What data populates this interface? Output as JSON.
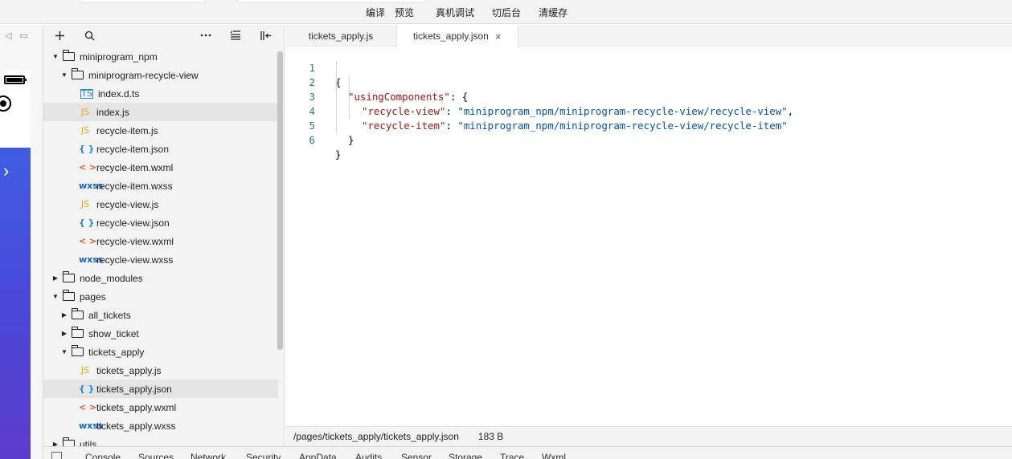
{
  "toolbar": {
    "actions": [
      "编译",
      "预览",
      "真机调试",
      "切后台",
      "清缓存"
    ]
  },
  "explorer": {
    "tree": [
      {
        "label": "miniprogram_npm",
        "type": "folder",
        "open": true,
        "depth": 0
      },
      {
        "label": "miniprogram-recycle-view",
        "type": "folder",
        "open": true,
        "depth": 1
      },
      {
        "label": "index.d.ts",
        "type": "ts",
        "depth": 2
      },
      {
        "label": "index.js",
        "type": "js",
        "depth": 2,
        "selected": true
      },
      {
        "label": "recycle-item.js",
        "type": "js",
        "depth": 2
      },
      {
        "label": "recycle-item.json",
        "type": "json",
        "depth": 2
      },
      {
        "label": "recycle-item.wxml",
        "type": "wxml",
        "depth": 2
      },
      {
        "label": "recycle-item.wxss",
        "type": "wxss",
        "depth": 2
      },
      {
        "label": "recycle-view.js",
        "type": "js",
        "depth": 2
      },
      {
        "label": "recycle-view.json",
        "type": "json",
        "depth": 2
      },
      {
        "label": "recycle-view.wxml",
        "type": "wxml",
        "depth": 2
      },
      {
        "label": "recycle-view.wxss",
        "type": "wxss",
        "depth": 2
      },
      {
        "label": "node_modules",
        "type": "folder",
        "open": false,
        "depth": 0
      },
      {
        "label": "pages",
        "type": "folder",
        "open": true,
        "depth": 0
      },
      {
        "label": "all_tickets",
        "type": "folder",
        "open": false,
        "depth": 1
      },
      {
        "label": "show_ticket",
        "type": "folder",
        "open": false,
        "depth": 1
      },
      {
        "label": "tickets_apply",
        "type": "folder",
        "open": true,
        "depth": 1
      },
      {
        "label": "tickets_apply.js",
        "type": "js",
        "depth": 2
      },
      {
        "label": "tickets_apply.json",
        "type": "json",
        "depth": 2,
        "selected": true
      },
      {
        "label": "tickets_apply.wxml",
        "type": "wxml",
        "depth": 2
      },
      {
        "label": "tickets_apply.wxss",
        "type": "wxss",
        "depth": 2
      },
      {
        "label": "utils",
        "type": "folder",
        "open": false,
        "depth": 0
      }
    ]
  },
  "editor": {
    "tabs": [
      {
        "label": "tickets_apply.js",
        "active": false
      },
      {
        "label": "tickets_apply.json",
        "active": true
      }
    ],
    "close_glyph": "×",
    "lines": [
      {
        "num": "1",
        "text": "{"
      },
      {
        "num": "2",
        "key": "\"usingComponents\"",
        "rest": ": {"
      },
      {
        "num": "3",
        "key": "\"recycle-view\"",
        "sep": ": ",
        "value": "\"miniprogram_npm/miniprogram-recycle-view/recycle-view\"",
        "tail": ","
      },
      {
        "num": "4",
        "key": "\"recycle-item\"",
        "sep": ": ",
        "value": "\"miniprogram_npm/miniprogram-recycle-view/recycle-item\"",
        "tail": ""
      },
      {
        "num": "5",
        "text": "}"
      },
      {
        "num": "6",
        "text": "}"
      }
    ]
  },
  "status": {
    "path": "/pages/tickets_apply/tickets_apply.json",
    "size": "183 B"
  },
  "devtools": {
    "tabs": [
      "Console",
      "Sources",
      "Network",
      "Security",
      "AppData",
      "Audits",
      "Sensor",
      "Storage",
      "Trace",
      "Wxml"
    ]
  },
  "icons": {
    "js": "JS",
    "json": "{ }",
    "wxml": "< >",
    "wxss": "wxss",
    "ts": "TS",
    "arrow_open": "▼",
    "arrow_closed": "▶",
    "chevron": "›"
  },
  "colors": {
    "code_key": "#a31515",
    "code_string": "#0451a5",
    "line_number": "#237893",
    "js_icon": "#e6a817",
    "json_icon": "#1e88e5",
    "wxml_icon": "#e8571c",
    "wxss_icon": "#1565c0",
    "simulator_gradient": [
      "#3f5de0",
      "#5c3ccc"
    ]
  }
}
